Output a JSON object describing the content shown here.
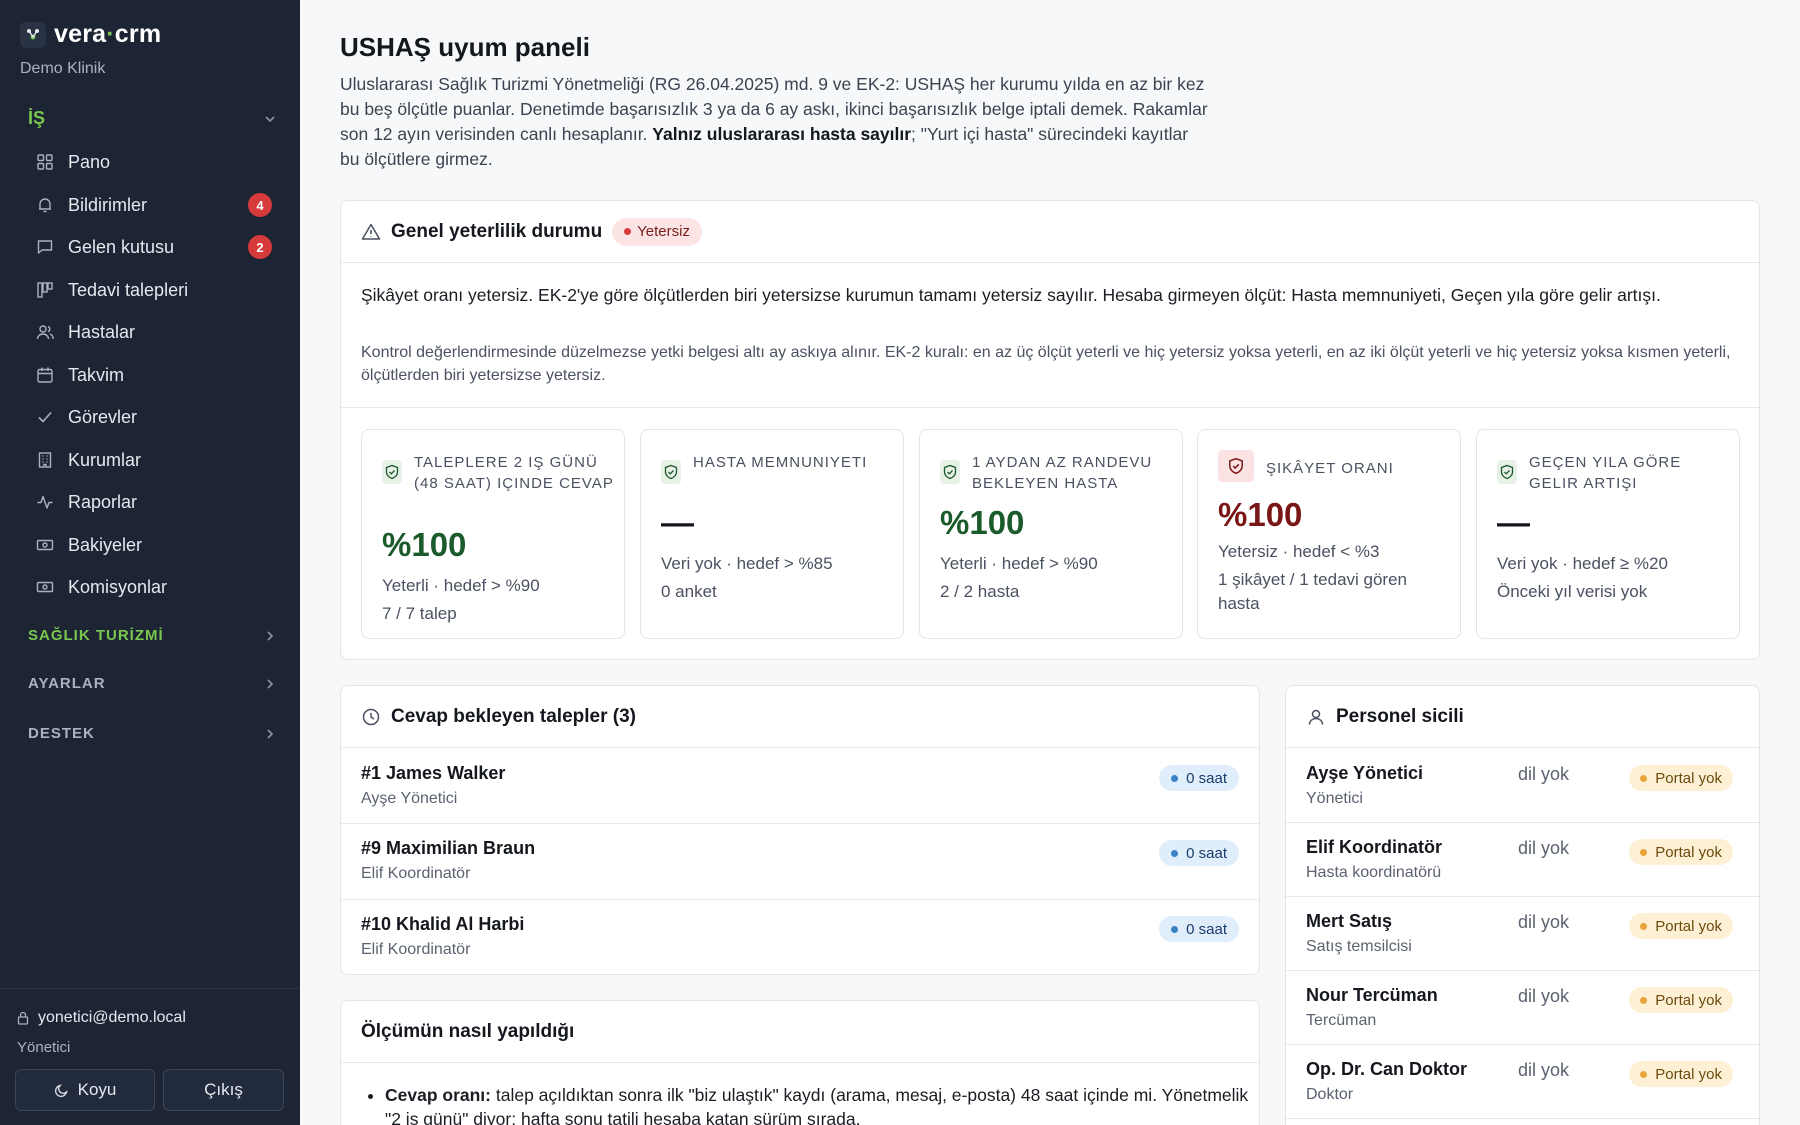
{
  "brand": {
    "name_left": "vera",
    "name_dot": "·",
    "name_right": "crm",
    "sub": "Demo Klinik"
  },
  "sidebar": {
    "group_is": "İŞ",
    "items": [
      {
        "label": "Pano",
        "icon": "grid-icon"
      },
      {
        "label": "Bildirimler",
        "icon": "bell-icon",
        "badge": "4"
      },
      {
        "label": "Gelen kutusu",
        "icon": "chat-icon",
        "badge": "2"
      },
      {
        "label": "Tedavi talepleri",
        "icon": "kanban-icon"
      },
      {
        "label": "Hastalar",
        "icon": "users-icon"
      },
      {
        "label": "Takvim",
        "icon": "calendar-icon"
      },
      {
        "label": "Görevler",
        "icon": "check-icon"
      },
      {
        "label": "Kurumlar",
        "icon": "building-icon"
      },
      {
        "label": "Raporlar",
        "icon": "activity-icon"
      },
      {
        "label": "Bakiyeler",
        "icon": "cash-icon"
      },
      {
        "label": "Komisyonlar",
        "icon": "cash-icon"
      }
    ],
    "groups": [
      "SAĞLIK TURİZMİ",
      "AYARLAR",
      "DESTEK"
    ],
    "user_email": "yonetici@demo.local",
    "user_role": "Yönetici",
    "theme_btn": "Koyu",
    "logout_btn": "Çıkış"
  },
  "page": {
    "title": "USHAŞ uyum paneli",
    "intro_1": "Uluslararası Sağlık Turizmi Yönetmeliği (RG 26.04.2025) md. 9 ve EK-2: USHAŞ her kurumu yılda en az bir kez bu beş ölçütle puanlar. Denetimde başarısızlık 3 ya da 6 ay askı, ikinci başarısızlık belge iptali demek. Rakamlar son 12 ayın verisinden canlı hesaplanır. ",
    "intro_bold": "Yalnız uluslararası hasta sayılır",
    "intro_2": "; \"Yurt içi hasta\" sürecindeki kayıtlar bu ölçütlere girmez."
  },
  "status": {
    "title": "Genel yeterlilik durumu",
    "badge": "Yetersiz",
    "main_text": "Şikâyet oranı yetersiz. EK-2'ye göre ölçütlerden biri yetersizse kurumun tamamı yetersiz sayılır. Hesaba girmeyen ölçüt: Hasta memnuniyeti, Geçen yıla göre gelir artışı.",
    "sub_text": "Kontrol değerlendirmesinde düzelmezse yetki belgesi altı ay askıya alınır. EK-2 kuralı: en az üç ölçüt yeterli ve hiç yetersiz yoksa yeterli, en az iki ölçüt yeterli ve hiç yetersiz yoksa kısmen yeterli, ölçütlerden biri yetersizse yetersiz."
  },
  "metrics": [
    {
      "title": "Taleplere 2 iş günü (48 saat) içinde cevap",
      "value": "%100",
      "line1": "Yeterli · hedef > %90",
      "line2": "7 / 7 talep",
      "state": "ok"
    },
    {
      "title": "Hasta memnuniyeti",
      "value": "—",
      "line1": "Veri yok · hedef > %85",
      "line2": "0 anket",
      "state": "none"
    },
    {
      "title": "1 aydan az randevu bekleyen hasta",
      "value": "%100",
      "line1": "Yeterli · hedef > %90",
      "line2": "2 / 2 hasta",
      "state": "ok"
    },
    {
      "title": "Şikâyet oranı",
      "value": "%100",
      "line1": "Yetersiz · hedef < %3",
      "line2": "1 şikâyet / 1 tedavi gören hasta",
      "state": "bad"
    },
    {
      "title": "Geçen yıla göre gelir artışı",
      "value": "—",
      "line1": "Veri yok · hedef ≥ %20",
      "line2": "Önceki yıl verisi yok",
      "state": "none"
    }
  ],
  "pending": {
    "title": "Cevap bekleyen talepler (3)",
    "rows": [
      {
        "name": "#1 James Walker",
        "sub": "Ayşe Yönetici",
        "badge": "0 saat"
      },
      {
        "name": "#9 Maximilian Braun",
        "sub": "Elif Koordinatör",
        "badge": "0 saat"
      },
      {
        "name": "#10 Khalid Al Harbi",
        "sub": "Elif Koordinatör",
        "badge": "0 saat"
      }
    ]
  },
  "method": {
    "title": "Ölçümün nasıl yapıldığı",
    "item1_bold": "Cevap oranı:",
    "item1_text": " talep açıldıktan sonra ilk \"biz ulaştık\" kaydı (arama, mesaj, e-posta) 48 saat içinde mi. Yönetmelik \"2 iş günü\" diyor; hafta sonu tatili hesaba katan sürüm sırada."
  },
  "staff": {
    "title": "Personel sicili",
    "rows": [
      {
        "name": "Ayşe Yönetici",
        "role": "Yönetici",
        "lang": "dil yok",
        "badge": "Portal yok"
      },
      {
        "name": "Elif Koordinatör",
        "role": "Hasta koordinatörü",
        "lang": "dil yok",
        "badge": "Portal yok"
      },
      {
        "name": "Mert Satış",
        "role": "Satış temsilcisi",
        "lang": "dil yok",
        "badge": "Portal yok"
      },
      {
        "name": "Nour Tercüman",
        "role": "Tercüman",
        "lang": "dil yok",
        "badge": "Portal yok"
      },
      {
        "name": "Op. Dr. Can Doktor",
        "role": "Doktor",
        "lang": "dil yok",
        "badge": "Portal yok"
      }
    ]
  },
  "colors": {
    "accent": "#7ac74f",
    "sidebar": "#1d2535",
    "danger": "#d63a3a",
    "ok": "#1b5a2a"
  }
}
